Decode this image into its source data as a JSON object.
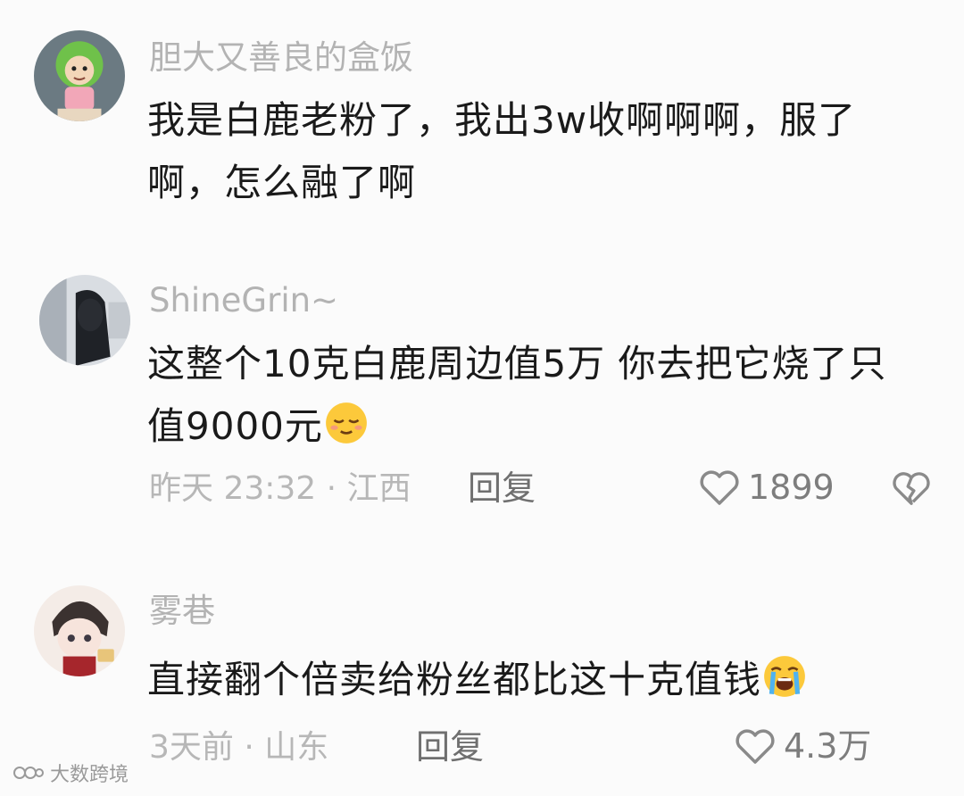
{
  "comments": [
    {
      "username": "胆大又善良的盒饭",
      "text": "我是白鹿老粉了，我出3w收啊啊啊，服了啊，怎么融了啊"
    },
    {
      "username": "ShineGrin~",
      "text": "这整个10克白鹿周边值5万 你去把它烧了只值9000元",
      "emoji": "relieved-face-emoji",
      "meta": "昨天 23:32 · 江西",
      "reply": "回复",
      "likes": "1899"
    },
    {
      "username": "雾巷",
      "text": "直接翻个倍卖给粉丝都比这十克值钱",
      "emoji": "loudly-crying-face-emoji",
      "meta": "3天前 · 山东",
      "reply": "回复",
      "likes": "4.3万"
    }
  ],
  "watermark": "大数跨境"
}
